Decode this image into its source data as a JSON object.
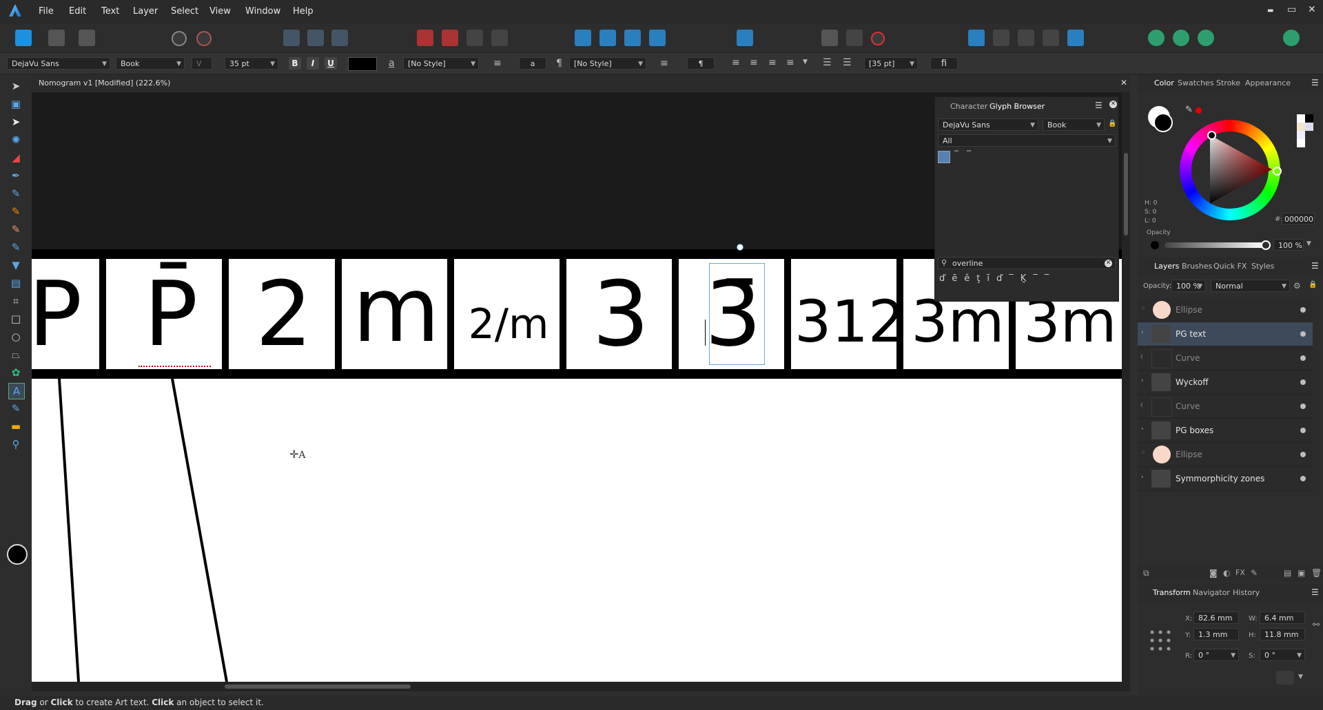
{
  "menu": [
    "File",
    "Edit",
    "Text",
    "Layer",
    "Select",
    "View",
    "Window",
    "Help"
  ],
  "window_controls": {
    "minimize": "▬",
    "restore": "▭",
    "close": "✕"
  },
  "context_bar": {
    "font_family": "DejaVu Sans",
    "font_style": "Book",
    "font_size": "35 pt",
    "bold": "B",
    "italic": "I",
    "underline": "U",
    "char_style_label": "a",
    "char_style": "[No Style]",
    "para_glyph": "¶",
    "para_style": "[No Style]",
    "leading": "[35 pt]",
    "ligature": "fi",
    "accent_color": "#000000"
  },
  "document": {
    "title": "Nomogram v1 [Modified] (222.6%)",
    "close": "✕"
  },
  "canvas_cells": [
    "P",
    "P̄",
    "2",
    "m",
    "2/m",
    "3",
    "3̄",
    "312",
    "3m",
    "3m"
  ],
  "glyph_browser": {
    "tabs": [
      "Character",
      "Glyph Browser"
    ],
    "font": "DejaVu Sans",
    "style": "Book",
    "subset": "All",
    "search": "overline",
    "result_glyphs": [
      "ď",
      "ē",
      "ě",
      "ţ",
      "ī",
      "ď",
      "‾",
      "Ḵ",
      "‾",
      "‾"
    ]
  },
  "color_panel": {
    "tabs": [
      "Color",
      "Swatches",
      "Stroke",
      "Appearance"
    ],
    "h": "H: 0",
    "s": "S: 0",
    "l": "L: 0",
    "hex_label": "#:",
    "hex": "000000",
    "opacity_label": "Opacity",
    "opacity": "100 %"
  },
  "layers_panel": {
    "tabs": [
      "Layers",
      "Brushes",
      "Quick FX",
      "Styles"
    ],
    "opacity_label": "Opacity:",
    "opacity": "100 %",
    "blend": "Normal",
    "rows": [
      {
        "name": "Ellipse",
        "type": "ellipse",
        "dim": true
      },
      {
        "name": "PG text",
        "type": "folder",
        "dim": false,
        "selected": true
      },
      {
        "name": "Curve",
        "type": "curve",
        "dim": true
      },
      {
        "name": "Wyckoff",
        "type": "folder",
        "dim": false
      },
      {
        "name": "Curve",
        "type": "curve",
        "dim": true
      },
      {
        "name": "PG boxes",
        "type": "folder",
        "dim": false
      },
      {
        "name": "Ellipse",
        "type": "ellipse",
        "dim": true
      },
      {
        "name": "Symmorphicity zones",
        "type": "folder",
        "dim": false
      }
    ]
  },
  "transform_panel": {
    "tabs": [
      "Transform",
      "Navigator",
      "History"
    ],
    "x_label": "X:",
    "x": "82.6 mm",
    "w_label": "W:",
    "w": "6.4 mm",
    "y_label": "Y:",
    "y": "1.3 mm",
    "h_label": "H:",
    "h": "11.8 mm",
    "r_label": "R:",
    "r": "0 °",
    "s_label": "S:",
    "s": "0 °"
  },
  "status": {
    "p1": "Drag",
    "p2": " or ",
    "p3": "Click",
    "p4": " to create Art text. ",
    "p5": "Click",
    "p6": " an object to select it."
  }
}
